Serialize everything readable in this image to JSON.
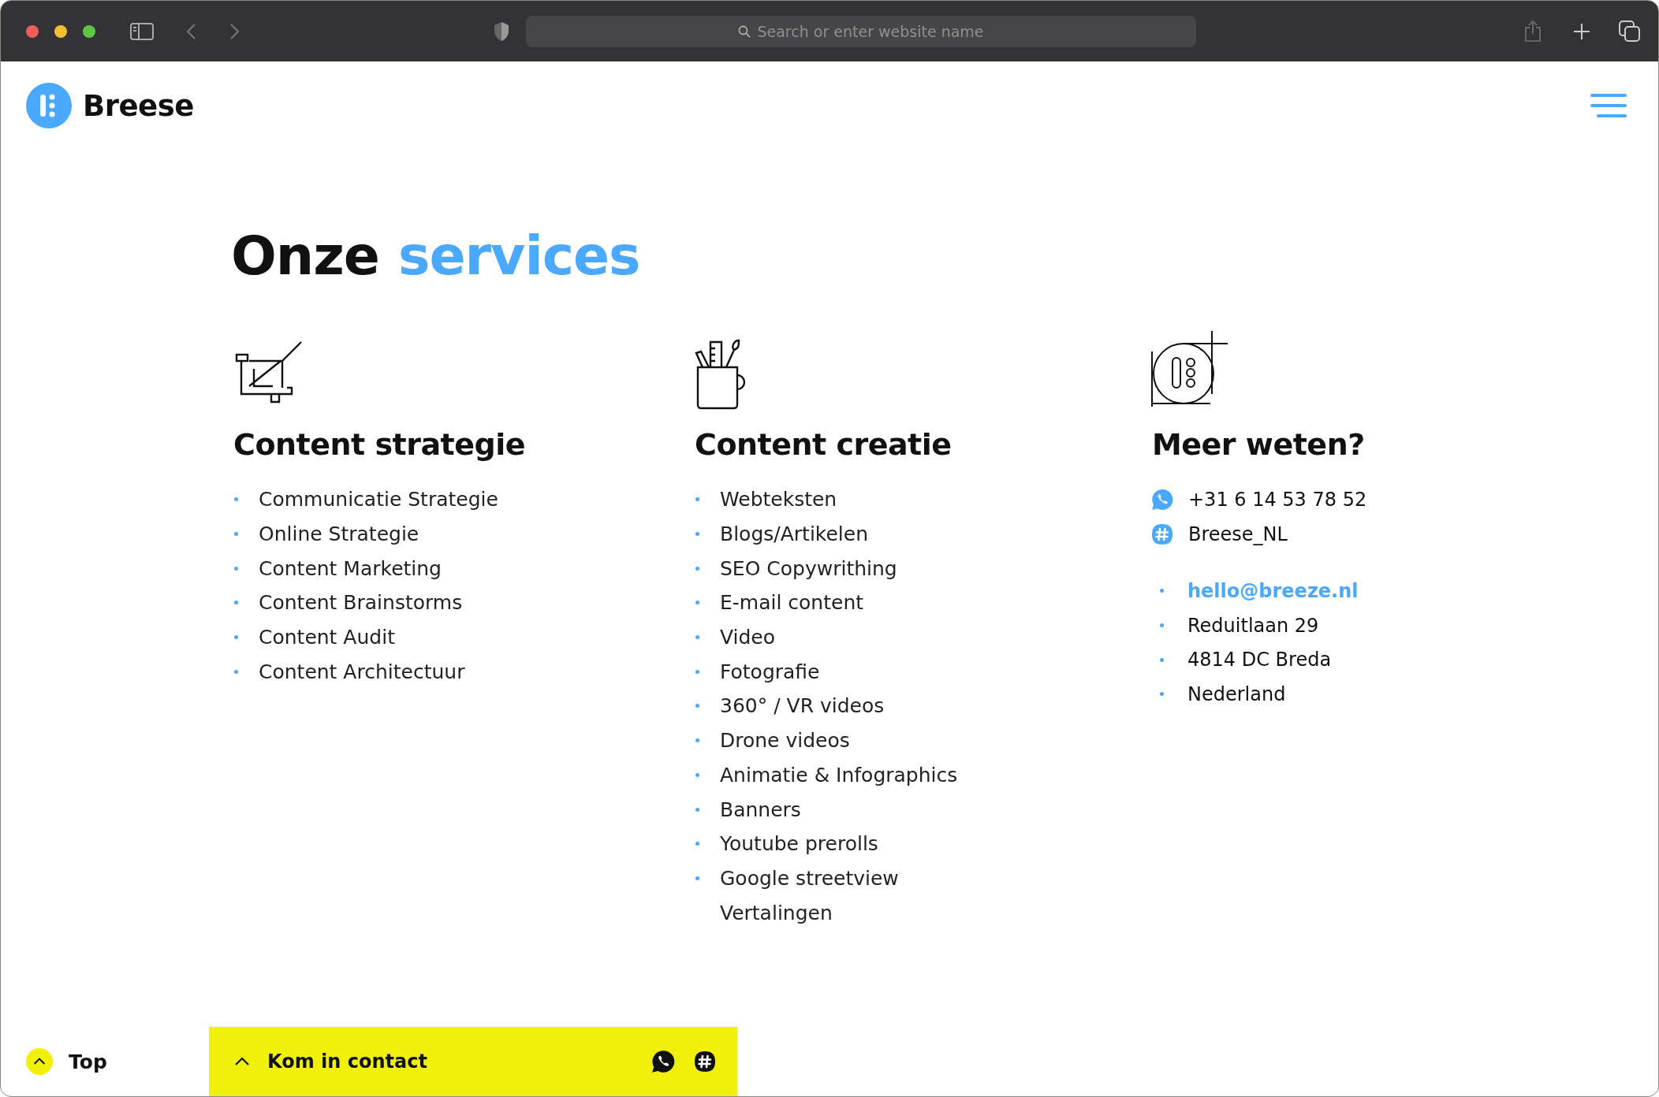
{
  "browser": {
    "address_placeholder": "Search or enter website name"
  },
  "header": {
    "logo_text": "Breese"
  },
  "heading": {
    "part_1": "Onze",
    "part_2": "services"
  },
  "columns": [
    {
      "kind": "strategy",
      "title": "Content strategie",
      "items": [
        {
          "text": "Communicatie Strategie",
          "bullet": true
        },
        {
          "text": "Online Strategie",
          "bullet": true
        },
        {
          "text": "Content Marketing",
          "bullet": true
        },
        {
          "text": "Content Brainstorms",
          "bullet": true
        },
        {
          "text": "Content Audit",
          "bullet": true
        },
        {
          "text": "Content Architectuur",
          "bullet": true
        }
      ]
    },
    {
      "kind": "creation",
      "title": "Content creatie",
      "items": [
        {
          "text": "Webteksten",
          "bullet": true
        },
        {
          "text": "Blogs/Artikelen",
          "bullet": true
        },
        {
          "text": "SEO Copywrithing",
          "bullet": true
        },
        {
          "text": "E-mail content",
          "bullet": true
        },
        {
          "text": "Video",
          "bullet": true
        },
        {
          "text": "Fotografie",
          "bullet": true
        },
        {
          "text": "360° / VR videos",
          "bullet": true
        },
        {
          "text": "Drone videos",
          "bullet": true
        },
        {
          "text": "Animatie & Infographics",
          "bullet": true
        },
        {
          "text": "Banners",
          "bullet": true
        },
        {
          "text": "Youtube prerolls",
          "bullet": true
        },
        {
          "text": "Google streetview",
          "bullet": true
        },
        {
          "text": "Vertalingen",
          "bullet": false
        }
      ]
    }
  ],
  "contact": {
    "title": "Meer weten?",
    "channels": [
      {
        "kind": "whatsapp",
        "text": "+31 6 14 53 78 52"
      },
      {
        "kind": "slack",
        "text": "Breese_NL"
      }
    ],
    "address": [
      {
        "kind": "link",
        "text": "hello@breeze.nl"
      },
      {
        "kind": "plain",
        "text": "Reduitlaan 29"
      },
      {
        "kind": "plain",
        "text": "4814 DC Breda"
      },
      {
        "kind": "plain",
        "text": "Nederland"
      }
    ]
  },
  "footer": {
    "top_label": "Top",
    "contact_label": "Kom in contact"
  }
}
